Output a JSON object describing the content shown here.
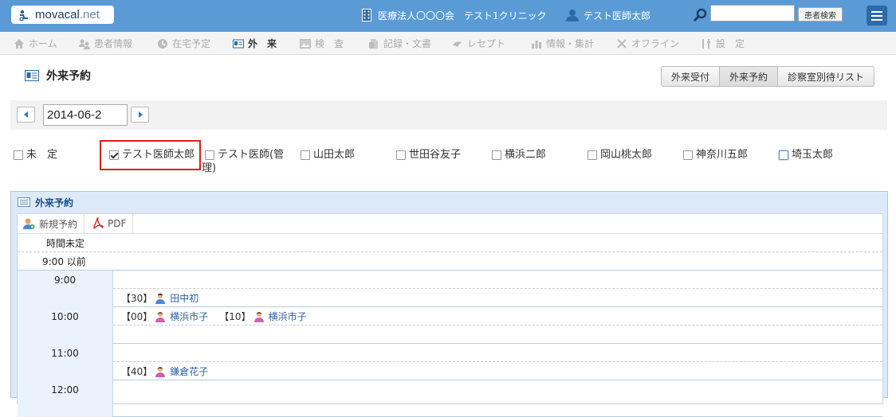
{
  "header": {
    "logo": {
      "main": "movacal",
      "suffix": ".net"
    },
    "org": "医療法人〇〇〇会　テスト1クリニック",
    "user": "テスト医師太郎",
    "search": {
      "value": "",
      "button": "患者検索"
    }
  },
  "nav": [
    {
      "label": "ホーム",
      "icon": "home-icon",
      "active": false
    },
    {
      "label": "患者情報",
      "icon": "patients-icon",
      "active": false
    },
    {
      "label": "在宅予定",
      "icon": "clock-icon",
      "active": false
    },
    {
      "label": "外　来",
      "icon": "id-card-icon",
      "active": true
    },
    {
      "label": "検　査",
      "icon": "image-icon",
      "active": false
    },
    {
      "label": "記録・文書",
      "icon": "document-icon",
      "active": false
    },
    {
      "label": "レセプト",
      "icon": "bird-icon",
      "active": false
    },
    {
      "label": "情報・集計",
      "icon": "chart-icon",
      "active": false
    },
    {
      "label": "オフライン",
      "icon": "offline-icon",
      "active": false
    },
    {
      "label": "設　定",
      "icon": "tools-icon",
      "active": false
    }
  ],
  "page": {
    "title": "外来予約",
    "tabs": [
      "外来受付",
      "外来予約",
      "診察室別待リスト"
    ],
    "selected_tab": "外来予約"
  },
  "date": {
    "value": "2014-06-2"
  },
  "doctors": [
    {
      "label": "未　定",
      "checked": false
    },
    {
      "label": "テスト医師太郎",
      "checked": true
    },
    {
      "label": "テスト医師(管理)",
      "checked": false
    },
    {
      "label": "山田太郎",
      "checked": false
    },
    {
      "label": "世田谷友子",
      "checked": false
    },
    {
      "label": "横浜二郎",
      "checked": false
    },
    {
      "label": "岡山桃太郎",
      "checked": false
    },
    {
      "label": "神奈川五郎",
      "checked": false
    },
    {
      "label": "埼玉太郎",
      "checked": false
    }
  ],
  "doctor_label_lines": {
    "kanri_line1": "テスト医師(管",
    "kanri_line2": "理)"
  },
  "panel": {
    "title": "外来予約",
    "toolbar": {
      "new": "新規予約",
      "pdf": "PDF"
    },
    "untimed": "時間未定",
    "before": "9:00 以前",
    "slots": [
      {
        "time": "9:00",
        "appts": [
          {
            "code": "【30】",
            "name": "田中初",
            "gender": "male"
          }
        ]
      },
      {
        "time": "10:00",
        "appts": [
          {
            "code": "【00】",
            "name": "横浜市子",
            "gender": "female"
          },
          {
            "code": "【10】",
            "name": "横浜市子",
            "gender": "female"
          }
        ],
        "top": true
      },
      {
        "time": "11:00",
        "appts": [
          {
            "code": "【40】",
            "name": "鎌倉花子",
            "gender": "female"
          }
        ]
      },
      {
        "time": "12:00",
        "appts": []
      }
    ]
  },
  "colors": {
    "topbar": "#5a9bd6",
    "accent": "#2a62a4",
    "highlight": "#d9201a",
    "panel": "#dceaf8"
  }
}
